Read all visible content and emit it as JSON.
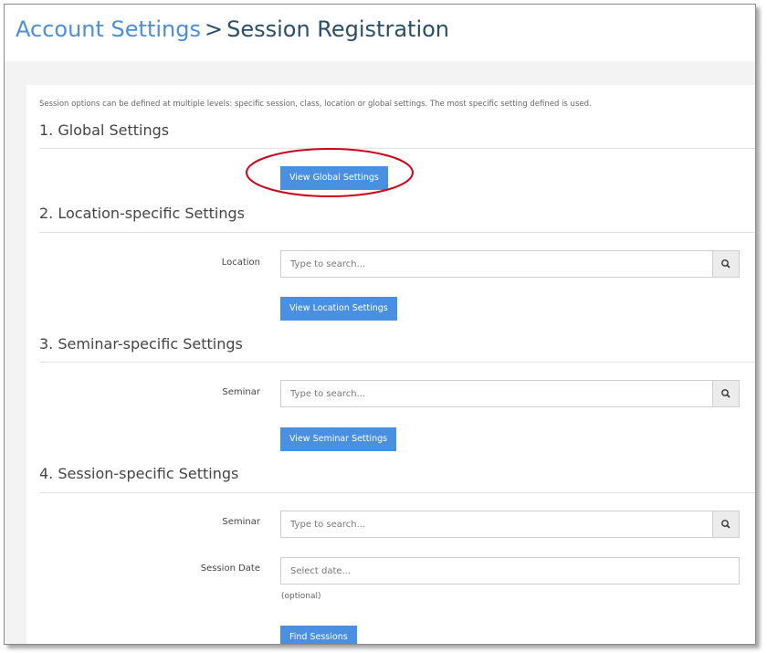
{
  "breadcrumb": {
    "parent": "Account Settings",
    "separator": ">",
    "current": "Session Registration"
  },
  "intro": "Session options can be defined at multiple levels: specific session, class, location or global settings. The most specific setting defined is used.",
  "sections": {
    "global": {
      "title": "1. Global Settings",
      "button": "View Global Settings"
    },
    "location": {
      "title": "2. Location-specific Settings",
      "field_label": "Location",
      "placeholder": "Type to search...",
      "button": "View Location Settings"
    },
    "seminar": {
      "title": "3. Seminar-specific Settings",
      "field_label": "Seminar",
      "placeholder": "Type to search...",
      "button": "View Seminar Settings"
    },
    "session": {
      "title": "4. Session-specific Settings",
      "seminar_label": "Seminar",
      "seminar_placeholder": "Type to search...",
      "date_label": "Session Date",
      "date_placeholder": "Select date...",
      "date_hint": "(optional)",
      "button": "Find Sessions"
    }
  },
  "icons": {
    "search": "search-icon"
  },
  "colors": {
    "accent": "#4a90e2",
    "link": "#4c8fd6",
    "annotation": "#d0021b"
  }
}
